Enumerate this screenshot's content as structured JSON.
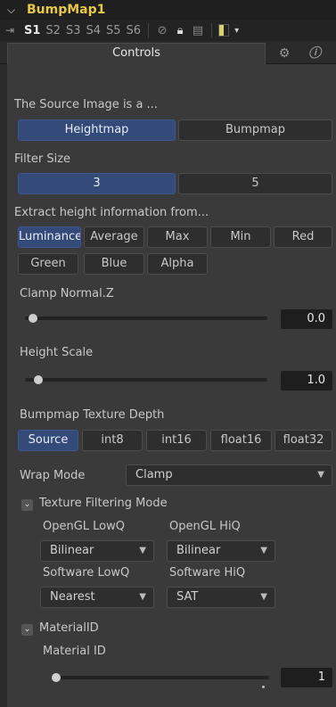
{
  "header": {
    "title": "BumpMap1"
  },
  "slots": {
    "labels": [
      "S1",
      "S2",
      "S3",
      "S4",
      "S5",
      "S6"
    ],
    "active": "S1"
  },
  "tabs": {
    "controls_label": "Controls"
  },
  "source_image": {
    "label": "The Source Image is a ...",
    "options": [
      "Heightmap",
      "Bumpmap"
    ],
    "selected": "Heightmap"
  },
  "filter_size": {
    "label": "Filter Size",
    "options": [
      "3",
      "5"
    ],
    "selected": "3"
  },
  "extract": {
    "label": "Extract height information from...",
    "options_row1": [
      "Luminance",
      "Average",
      "Max",
      "Min",
      "Red"
    ],
    "options_row2": [
      "Green",
      "Blue",
      "Alpha"
    ],
    "selected": "Luminance"
  },
  "clamp_normal": {
    "label": "Clamp Normal.Z",
    "value": "0.0"
  },
  "height_scale": {
    "label": "Height Scale",
    "value": "1.0"
  },
  "depth": {
    "label": "Bumpmap Texture Depth",
    "options": [
      "Source",
      "int8",
      "int16",
      "float16",
      "float32"
    ],
    "selected": "Source"
  },
  "wrap_mode": {
    "label": "Wrap Mode",
    "value": "Clamp"
  },
  "texture_filtering": {
    "label": "Texture Filtering Mode",
    "opengl_lowq_label": "OpenGL LowQ",
    "opengl_lowq_value": "Bilinear",
    "opengl_hiq_label": "OpenGL HiQ",
    "opengl_hiq_value": "Bilinear",
    "software_lowq_label": "Software LowQ",
    "software_lowq_value": "Nearest",
    "software_hiq_label": "Software HiQ",
    "software_hiq_value": "SAT"
  },
  "material": {
    "section_label": "MaterialID",
    "field_label": "Material ID",
    "value": "1"
  }
}
